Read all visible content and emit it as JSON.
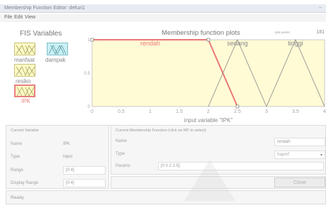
{
  "window": {
    "title": "Membership Function Editor: defuzi1",
    "minimize_glyph": "–"
  },
  "menu": {
    "items": [
      "File",
      "Edit",
      "View"
    ]
  },
  "fis": {
    "title": "FIS Variables",
    "inputs": [
      "manfaat",
      "resiko",
      "IPK"
    ],
    "outputs": [
      "dampak"
    ],
    "selected": "IPK"
  },
  "plot": {
    "title": "Membership function plots",
    "plot_points_label": "plot points:",
    "plot_points": "181",
    "xlabel": "input variable \"IPK\""
  },
  "chart_data": {
    "type": "line",
    "xlim": [
      0,
      4
    ],
    "ylim": [
      0,
      1
    ],
    "x_ticks": [
      "0",
      "0.5",
      "1",
      "1.5",
      "2",
      "2.5",
      "3",
      "3.5",
      "4"
    ],
    "y_ticks": [
      "0",
      "0.5",
      "1"
    ],
    "series": [
      {
        "name": "rendah",
        "points": [
          [
            0,
            1
          ],
          [
            2,
            1
          ],
          [
            2.5,
            0
          ]
        ],
        "color": "#e8797a",
        "selected": true
      },
      {
        "name": "sedang",
        "points": [
          [
            2,
            0
          ],
          [
            2.5,
            1
          ],
          [
            3,
            0
          ]
        ],
        "color": "#888888",
        "selected": false
      },
      {
        "name": "tinggi",
        "points": [
          [
            3,
            0
          ],
          [
            3.5,
            1
          ],
          [
            4,
            0
          ]
        ],
        "color": "#888888",
        "selected": false
      }
    ]
  },
  "current_variable": {
    "header": "Current Variable",
    "name_label": "Name",
    "name_value": "IPK",
    "type_label": "Type",
    "type_value": "input",
    "range_label": "Range",
    "range_value": "[0 4]",
    "display_range_label": "Display Range",
    "display_range_value": "[0 4]"
  },
  "current_mf": {
    "header": "Current Membership Function (click on MF to select)",
    "name_label": "Name",
    "name_value": "rendah",
    "type_label": "Type",
    "type_value": "trapmf",
    "params_label": "Params",
    "params_value": "[0 0 2 2.5]"
  },
  "buttons": {
    "close": "Close"
  },
  "status": "Ready",
  "colors": {
    "plot_bg": "#fffbd5",
    "selected_mf": "#e8797a",
    "input_box": "#fffbc7",
    "output_box": "#c8f0f4"
  }
}
